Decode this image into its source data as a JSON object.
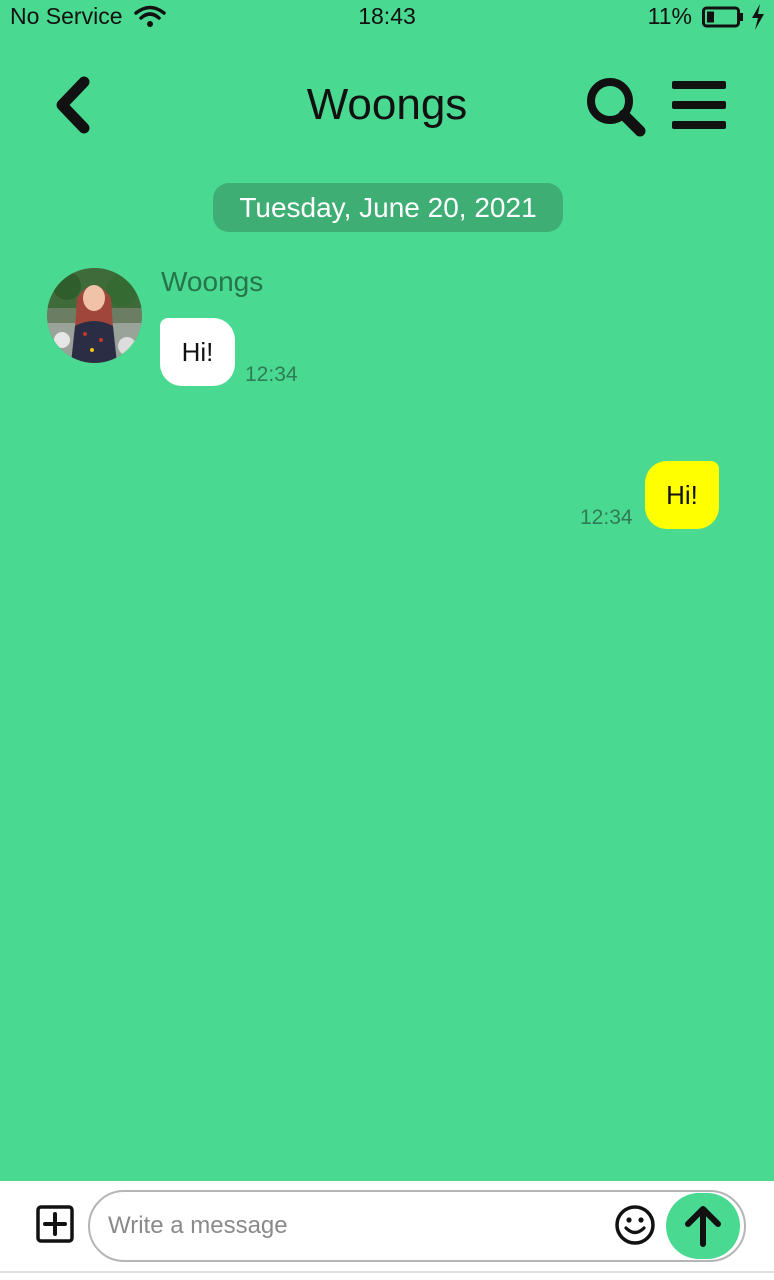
{
  "status_bar": {
    "carrier": "No Service",
    "time": "18:43",
    "battery": "11%"
  },
  "header": {
    "title": "Woongs"
  },
  "conversation": {
    "date": "Tuesday, June 20, 2021",
    "incoming": {
      "sender": "Woongs",
      "text": "Hi!",
      "time": "12:34"
    },
    "outgoing": {
      "text": "Hi!",
      "time": "12:34"
    }
  },
  "composer": {
    "placeholder": "Write a message"
  },
  "colors": {
    "background": "#4ad991",
    "date_pill": "#3fae74",
    "incoming_bubble": "#ffffff",
    "outgoing_bubble": "#ffff00",
    "send_button": "#4ad991"
  },
  "icons": [
    "wifi-icon",
    "battery-icon",
    "charging-icon",
    "back-icon",
    "search-icon",
    "menu-icon",
    "add-icon",
    "emoji-icon",
    "send-arrow-icon"
  ]
}
